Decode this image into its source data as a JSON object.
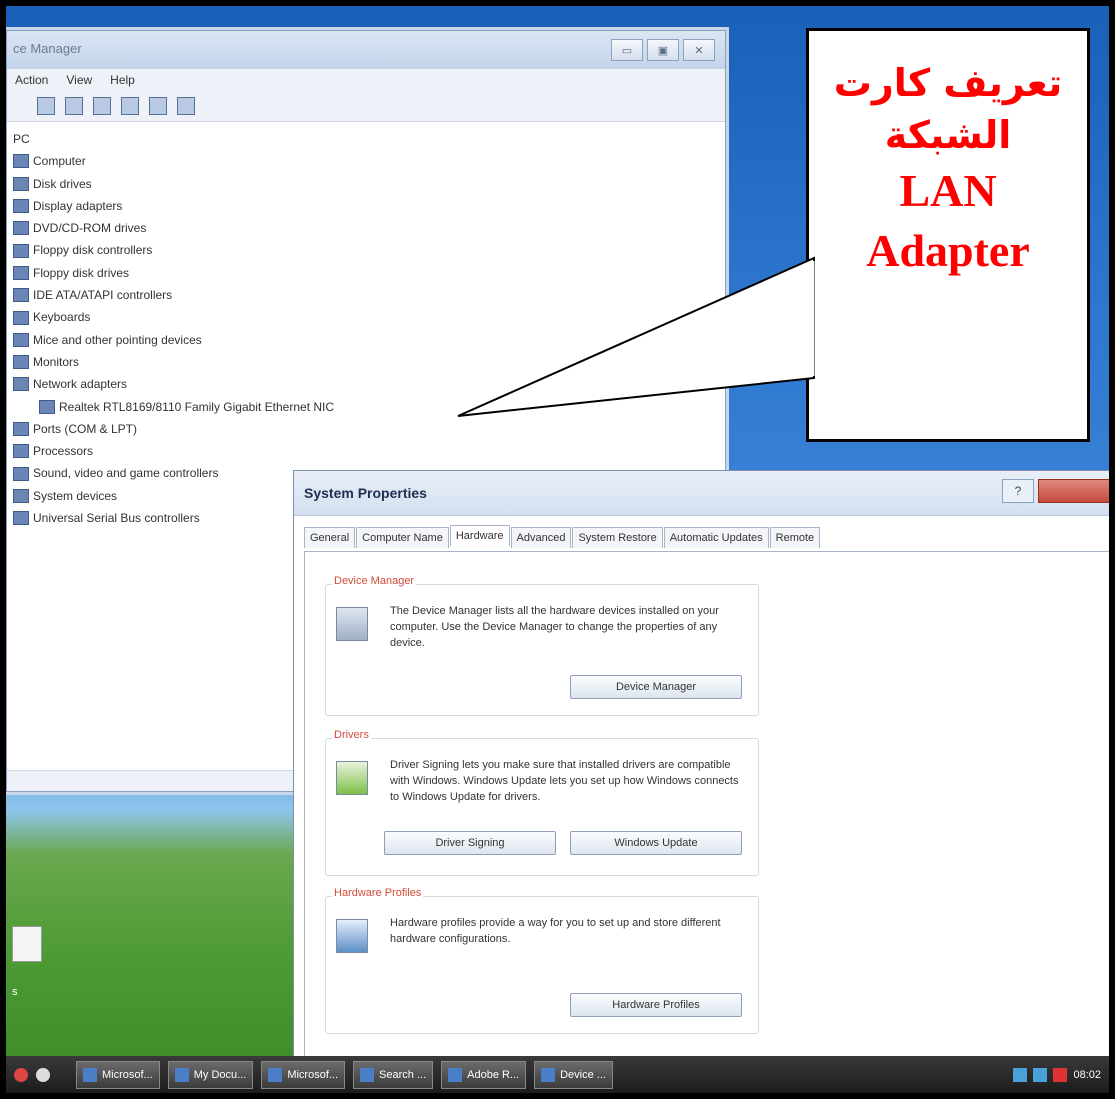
{
  "device_manager": {
    "title": "ce Manager",
    "menu": [
      "Action",
      "View",
      "Help"
    ],
    "window_buttons": [
      "▭",
      "▣",
      "✕"
    ],
    "tree": [
      {
        "label": "PC",
        "level": 0
      },
      {
        "label": "Computer",
        "level": 1
      },
      {
        "label": "Disk drives",
        "level": 1
      },
      {
        "label": "Display adapters",
        "level": 1
      },
      {
        "label": "DVD/CD-ROM drives",
        "level": 1
      },
      {
        "label": "Floppy disk controllers",
        "level": 1
      },
      {
        "label": "Floppy disk drives",
        "level": 1
      },
      {
        "label": "IDE ATA/ATAPI controllers",
        "level": 1
      },
      {
        "label": "Keyboards",
        "level": 1
      },
      {
        "label": "Mice and other pointing devices",
        "level": 1
      },
      {
        "label": "Monitors",
        "level": 1
      },
      {
        "label": "Network adapters",
        "level": 1
      },
      {
        "label": "Realtek RTL8169/8110 Family Gigabit Ethernet NIC",
        "level": 2
      },
      {
        "label": "Ports (COM & LPT)",
        "level": 1
      },
      {
        "label": "Processors",
        "level": 1
      },
      {
        "label": "Sound, video and game controllers",
        "level": 1
      },
      {
        "label": "System devices",
        "level": 1
      },
      {
        "label": "Universal Serial Bus controllers",
        "level": 1
      }
    ]
  },
  "callout": {
    "arabic_line1": "تعريف كارت",
    "arabic_line2": "الشبكة",
    "english_line1": "LAN",
    "english_line2": "Adapter",
    "text_color": "#ff0000"
  },
  "system_properties": {
    "title": "System Properties",
    "help_label": "?",
    "tabs": [
      "General",
      "Computer Name",
      "Hardware",
      "Advanced",
      "System Restore",
      "Automatic Updates",
      "Remote"
    ],
    "active_tab": "Hardware",
    "groups": {
      "device_manager": {
        "legend": "Device Manager",
        "text": "The Device Manager lists all the hardware devices installed on your computer. Use the Device Manager to change the properties of any device.",
        "button": "Device Manager"
      },
      "drivers": {
        "legend": "Drivers",
        "text": "Driver Signing lets you make sure that installed drivers are compatible with Windows. Windows Update lets you set up how Windows connects to Windows Update for drivers.",
        "button_signing": "Driver Signing",
        "button_update": "Windows Update"
      },
      "hardware_profiles": {
        "legend": "Hardware Profiles",
        "text": "Hardware profiles provide a way for you to set up and store different hardware configurations.",
        "button": "Hardware Profiles"
      }
    }
  },
  "desktop": {
    "icon_label": "s"
  },
  "taskbar": {
    "buttons": [
      "Microsof...",
      "My Docu...",
      "Microsof...",
      "Search ...",
      "Adobe R...",
      "Device ..."
    ],
    "clock": "08:02"
  }
}
